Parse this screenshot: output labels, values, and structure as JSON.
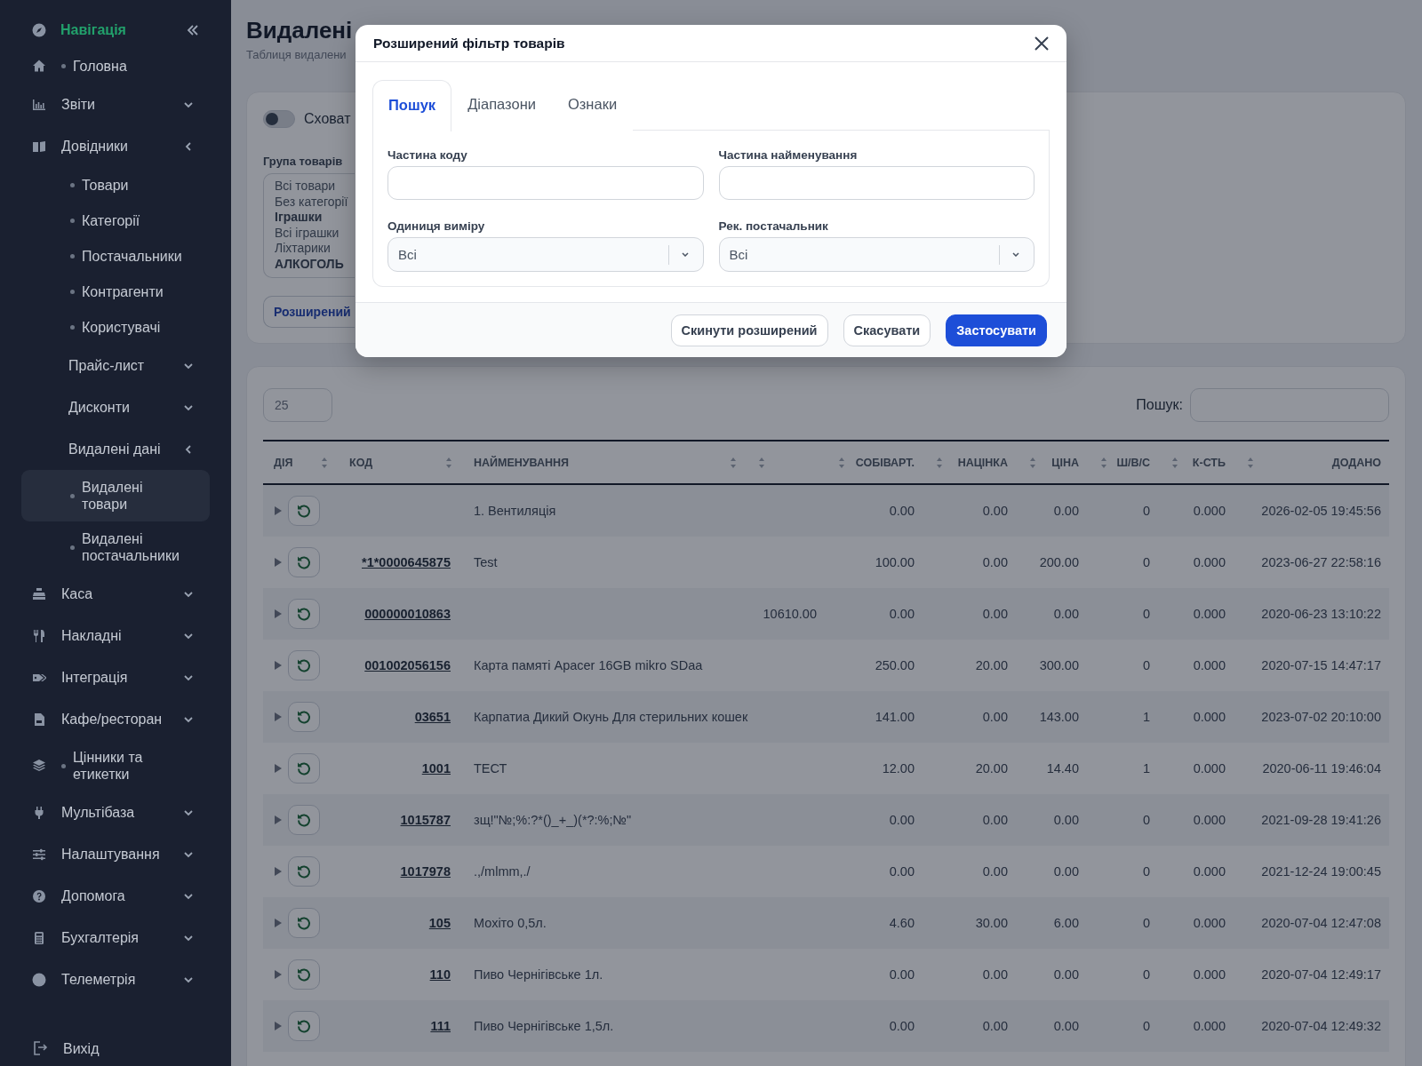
{
  "sidebar": {
    "title": "Навігація",
    "items": [
      {
        "kind": "link",
        "label": "Головна",
        "selected": false
      },
      {
        "kind": "group",
        "label": "Звіти",
        "expanded": false
      },
      {
        "kind": "group",
        "label": "Довідники",
        "expanded": true,
        "children": [
          {
            "kind": "link",
            "label": "Товари",
            "selected": false
          },
          {
            "kind": "link",
            "label": "Категорії",
            "selected": false
          },
          {
            "kind": "link",
            "label": "Постачальники",
            "selected": false
          },
          {
            "kind": "link",
            "label": "Контрагенти",
            "selected": false
          },
          {
            "kind": "link",
            "label": "Користувачі",
            "selected": false
          },
          {
            "kind": "group",
            "label": "Прайс-лист",
            "expanded": false
          },
          {
            "kind": "group",
            "label": "Дисконти",
            "expanded": false
          },
          {
            "kind": "group",
            "label": "Видалені дані",
            "expanded": true,
            "children": [
              {
                "kind": "link",
                "label": "Видалені товари",
                "selected": true
              },
              {
                "kind": "link",
                "label": "Видалені постачальники",
                "selected": false
              }
            ]
          }
        ]
      },
      {
        "kind": "group",
        "label": "Каса",
        "expanded": false
      },
      {
        "kind": "group",
        "label": "Накладні",
        "expanded": false
      },
      {
        "kind": "group",
        "label": "Інтеграція",
        "expanded": false
      },
      {
        "kind": "group",
        "label": "Кафе/ресторан",
        "expanded": false
      },
      {
        "kind": "link",
        "label": "Цінники та етикетки",
        "selected": false
      },
      {
        "kind": "group",
        "label": "Мультібаза",
        "expanded": false
      },
      {
        "kind": "group",
        "label": "Налаштування",
        "expanded": false
      },
      {
        "kind": "group",
        "label": "Допомога",
        "expanded": false
      },
      {
        "kind": "group",
        "label": "Бухгалтерія",
        "expanded": false
      },
      {
        "kind": "group",
        "label": "Телеметрія",
        "expanded": false
      }
    ],
    "logout": "Вихід"
  },
  "page": {
    "title": "Видалені",
    "subtitle": "Таблиця видалени"
  },
  "filter": {
    "hide_toggle": {
      "label": "Сховат",
      "on": false
    },
    "group_list": {
      "label": "Група товарів",
      "options": [
        {
          "label": "Всі товари",
          "kind": "option"
        },
        {
          "label": "Без категорії",
          "kind": "option"
        },
        {
          "label": "Іграшки",
          "kind": "category"
        },
        {
          "label": "Всі іграшки",
          "kind": "option"
        },
        {
          "label": "Ліхтарики",
          "kind": "option"
        },
        {
          "label": "АЛКОГОЛЬ",
          "kind": "category"
        }
      ]
    },
    "advanced_button": "Розширений"
  },
  "table": {
    "page_size": "25",
    "search_label": "Пошук:",
    "columns": [
      {
        "label": "ДІЯ",
        "kind": "text"
      },
      {
        "label": "КОД",
        "kind": "text"
      },
      {
        "label": "НАЙМЕНУВАННЯ",
        "kind": "text"
      },
      {
        "kind": "numeric"
      },
      {
        "label": "СОБІВАРТ.",
        "kind": "numeric"
      },
      {
        "label": "НАЦІНКА",
        "kind": "numeric"
      },
      {
        "label": "ЦІНА",
        "kind": "numeric"
      },
      {
        "label": "Ш/В/С",
        "kind": "numeric"
      },
      {
        "label": "К-СТЬ",
        "kind": "numeric"
      },
      {
        "label": "ДОДАНО",
        "kind": "numeric"
      }
    ],
    "rows": [
      {
        "name": "1. Вентиляція",
        "cost": "0.00",
        "markup": "0.00",
        "price": "0.00",
        "shvs": "0",
        "qty": "0.000",
        "added": "2026-02-05 19:45:56"
      },
      {
        "code": "*1*0000645875",
        "name": "Test",
        "cost": "100.00",
        "markup": "0.00",
        "price": "200.00",
        "shvs": "0",
        "qty": "0.000",
        "added": "2023-06-27 22:58:16"
      },
      {
        "code": "000000010863",
        "column_4": "10610.00",
        "cost": "0.00",
        "markup": "0.00",
        "price": "0.00",
        "shvs": "0",
        "qty": "0.000",
        "added": "2020-06-23 13:10:22"
      },
      {
        "code": "001002056156",
        "name": "Карта памяті Apacer 16GB mikro SDaa",
        "cost": "250.00",
        "markup": "20.00",
        "price": "300.00",
        "shvs": "0",
        "qty": "0.000",
        "added": "2020-07-15 14:47:17"
      },
      {
        "code": "03651",
        "name": "Карпатиа Дикий Окунь Для стерильних кошек",
        "cost": "141.00",
        "markup": "0.00",
        "price": "143.00",
        "shvs": "1",
        "qty": "0.000",
        "added": "2023-07-02 20:10:00"
      },
      {
        "code": "1001",
        "name": "ТЕСТ",
        "cost": "12.00",
        "markup": "20.00",
        "price": "14.40",
        "shvs": "1",
        "qty": "0.000",
        "added": "2020-06-11 19:46:04"
      },
      {
        "code": "1015787",
        "name": "зщ!\"№;%:?*()_+_)(*?:%;№\"",
        "cost": "0.00",
        "markup": "0.00",
        "price": "0.00",
        "shvs": "0",
        "qty": "0.000",
        "added": "2021-09-28 19:41:26"
      },
      {
        "code": "1017978",
        "name": ".,/mlmm,./",
        "cost": "0.00",
        "markup": "0.00",
        "price": "0.00",
        "shvs": "0",
        "qty": "0.000",
        "added": "2021-12-24 19:00:45"
      },
      {
        "code": "105",
        "name": "Мохіто 0,5л.",
        "cost": "4.60",
        "markup": "30.00",
        "price": "6.00",
        "shvs": "0",
        "qty": "0.000",
        "added": "2020-07-04 12:47:08"
      },
      {
        "code": "110",
        "name": "Пиво Чернігівське 1л.",
        "cost": "0.00",
        "markup": "0.00",
        "price": "0.00",
        "shvs": "0",
        "qty": "0.000",
        "added": "2020-07-04 12:49:17"
      },
      {
        "code": "111",
        "name": "Пиво Чернігівське 1,5л.",
        "cost": "0.00",
        "markup": "0.00",
        "price": "0.00",
        "shvs": "0",
        "qty": "0.000",
        "added": "2020-07-04 12:49:32"
      }
    ]
  },
  "modal": {
    "title": "Розширений фільтр товарів",
    "tabs": [
      {
        "label": "Пошук",
        "selected": true
      },
      {
        "label": "Діапазони",
        "selected": false
      },
      {
        "label": "Ознаки",
        "selected": false
      }
    ],
    "fields": [
      {
        "label": "Частина коду",
        "kind": "text"
      },
      {
        "label": "Частина найменування",
        "kind": "text"
      },
      {
        "label": "Одиниця виміру",
        "kind": "select",
        "value": "Всі"
      },
      {
        "label": "Рек. постачальник",
        "kind": "select",
        "value": "Всі"
      }
    ],
    "buttons": [
      {
        "label": "Скинути розширений",
        "kind": "secondary"
      },
      {
        "label": "Скасувати",
        "kind": "secondary"
      },
      {
        "label": "Застосувати",
        "kind": "primary"
      }
    ]
  }
}
